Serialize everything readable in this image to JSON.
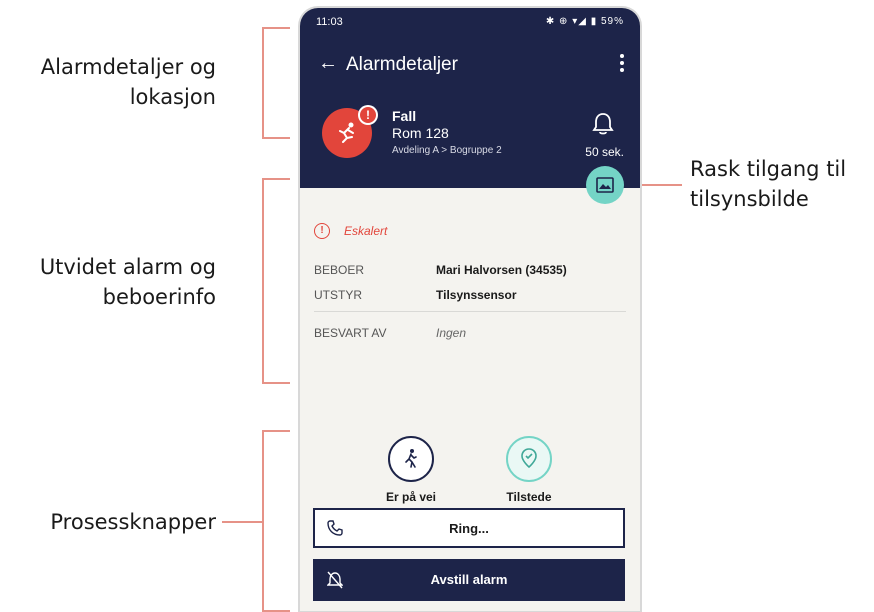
{
  "annotations": {
    "alarm_details_line1": "Alarmdetaljer og",
    "alarm_details_line2": "lokasjon",
    "extended_line1": "Utvidet alarm og",
    "extended_line2": "beboerinfo",
    "quick_access_line1": "Rask tilgang til",
    "quick_access_line2": "tilsynsbilde",
    "process_buttons": "Prosessknapper"
  },
  "status_bar": {
    "time": "11:03",
    "icons": "✱ ⊕ ▾◢ ▮ 59%"
  },
  "header": {
    "title": "Alarmdetaljer",
    "back_icon": "arrow-left-icon",
    "menu_icon": "more-vertical-icon"
  },
  "alarm": {
    "type": "Fall",
    "room": "Rom 128",
    "location": "Avdeling A > Bogruppe 2",
    "elapsed": "50 sek.",
    "badge": "!",
    "accent_color": "#e2453b"
  },
  "details": {
    "escalated_label": "Eskalert",
    "rows": [
      {
        "label": "BEBOER",
        "value": "Mari Halvorsen (34535)"
      },
      {
        "label": "UTSTYR",
        "value": "Tilsynssensor"
      },
      {
        "label": "BESVART AV",
        "value": "Ingen"
      }
    ]
  },
  "process": {
    "on_the_way": "Er på vei",
    "present": "Tilstede",
    "ring": "Ring...",
    "reset_alarm": "Avstill alarm"
  },
  "colors": {
    "header_bg": "#1d2449",
    "teal": "#74d4c6",
    "bracket": "#e69287"
  }
}
